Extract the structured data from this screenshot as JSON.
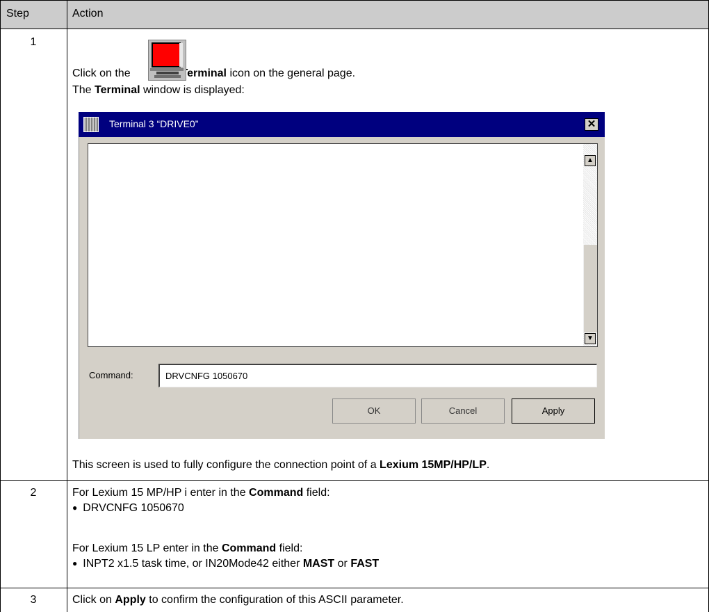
{
  "table": {
    "headers": {
      "step": "Step",
      "action": "Action"
    },
    "rows": [
      {
        "step": "1",
        "line1_pre": "Click on the",
        "line1_bold": "Terminal",
        "line1_post": "icon on the general page.",
        "line2_pre": "The",
        "line2_bold": "Terminal",
        "line2_post": "window is displayed:",
        "footer_pre": "This screen is used to fully configure the connection point of a",
        "footer_bold": "Lexium 15MP/HP/LP",
        "footer_post": "."
      },
      {
        "step": "2",
        "p1_pre": "For Lexium 15 MP/HP i enter in the",
        "p1_bold": "Command",
        "p1_post": "field:",
        "bullet1": "DRVCNFG 1050670",
        "p2_pre": "For Lexium 15 LP enter in the",
        "p2_bold": "Command",
        "p2_post": "field:",
        "bullet2_pre": "INPT2 x1.5 task time, or IN20Mode42 either",
        "bullet2_bold1": "MAST",
        "bullet2_mid": "or",
        "bullet2_bold2": "FAST"
      },
      {
        "step": "3",
        "pre": "Click on",
        "bold": "Apply",
        "post": "to confirm the configuration of this ASCII parameter."
      }
    ]
  },
  "dialog": {
    "title": "Terminal 3 “DRIVE0”",
    "close_glyph": "✕",
    "command_label": "Command:",
    "command_value": "DRVCNFG 1050670",
    "buttons": {
      "ok": "OK",
      "cancel": "Cancel",
      "apply": "Apply"
    }
  },
  "icons": [
    "terminal-icon",
    "window-system-icon",
    "close-icon",
    "scroll-up-arrow-icon",
    "scroll-down-arrow-icon"
  ],
  "colors": {
    "header_bg": "#cccccc",
    "titlebar": "#00007f",
    "dialog_face": "#d4d0c8",
    "terminal_screen": "#ff0000"
  }
}
